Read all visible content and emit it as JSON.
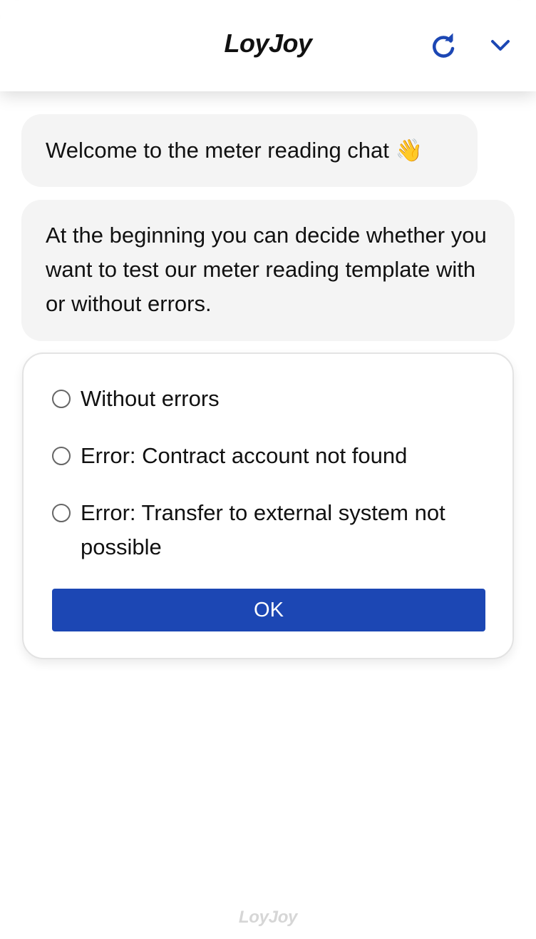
{
  "header": {
    "brand": "LoyJoy",
    "refresh_icon": "refresh-icon",
    "collapse_icon": "chevron-down-icon",
    "accent_color": "#1c47b4"
  },
  "messages": [
    {
      "text": "Welcome to the meter reading chat 👋"
    },
    {
      "text": "At the beginning you can decide whether you want to test our meter reading template with or without errors."
    }
  ],
  "choice_card": {
    "options": [
      {
        "label": "Without errors"
      },
      {
        "label": "Error: Contract account not found"
      },
      {
        "label": "Error: Transfer to external system not possible"
      }
    ],
    "ok_label": "OK"
  },
  "footer": {
    "brand": "LoyJoy"
  }
}
